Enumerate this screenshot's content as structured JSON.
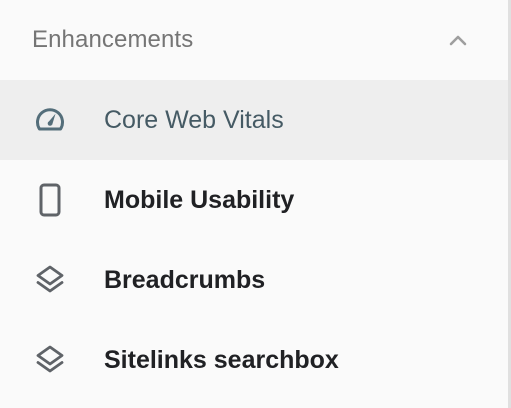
{
  "section": {
    "title": "Enhancements",
    "expanded": true,
    "toggle_icon": "chevron-up-icon"
  },
  "items": [
    {
      "label": "Core Web Vitals",
      "icon": "speedometer-icon",
      "selected": true
    },
    {
      "label": "Mobile Usability",
      "icon": "smartphone-icon",
      "selected": false
    },
    {
      "label": "Breadcrumbs",
      "icon": "layers-icon",
      "selected": false
    },
    {
      "label": "Sitelinks searchbox",
      "icon": "layers-icon",
      "selected": false
    }
  ],
  "colors": {
    "background": "#fafafa",
    "selected_background": "#eeeeee",
    "selected_text": "#455a64",
    "text": "#202124",
    "header_text": "#757575",
    "icon": "#5f6368"
  }
}
